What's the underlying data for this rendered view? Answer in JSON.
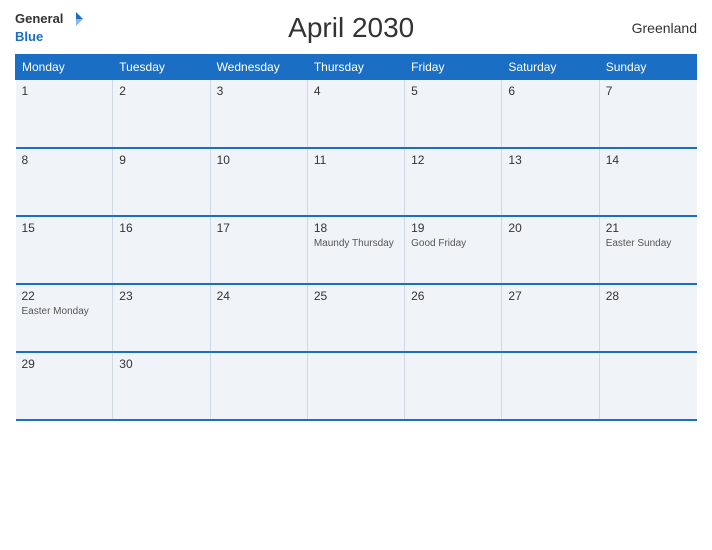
{
  "header": {
    "logo_general": "General",
    "logo_blue": "Blue",
    "title": "April 2030",
    "region": "Greenland"
  },
  "calendar": {
    "weekdays": [
      "Monday",
      "Tuesday",
      "Wednesday",
      "Thursday",
      "Friday",
      "Saturday",
      "Sunday"
    ],
    "weeks": [
      [
        {
          "day": "1",
          "event": ""
        },
        {
          "day": "2",
          "event": ""
        },
        {
          "day": "3",
          "event": ""
        },
        {
          "day": "4",
          "event": ""
        },
        {
          "day": "5",
          "event": ""
        },
        {
          "day": "6",
          "event": ""
        },
        {
          "day": "7",
          "event": ""
        }
      ],
      [
        {
          "day": "8",
          "event": ""
        },
        {
          "day": "9",
          "event": ""
        },
        {
          "day": "10",
          "event": ""
        },
        {
          "day": "11",
          "event": ""
        },
        {
          "day": "12",
          "event": ""
        },
        {
          "day": "13",
          "event": ""
        },
        {
          "day": "14",
          "event": ""
        }
      ],
      [
        {
          "day": "15",
          "event": ""
        },
        {
          "day": "16",
          "event": ""
        },
        {
          "day": "17",
          "event": ""
        },
        {
          "day": "18",
          "event": "Maundy Thursday"
        },
        {
          "day": "19",
          "event": "Good Friday"
        },
        {
          "day": "20",
          "event": ""
        },
        {
          "day": "21",
          "event": "Easter Sunday"
        }
      ],
      [
        {
          "day": "22",
          "event": "Easter Monday"
        },
        {
          "day": "23",
          "event": ""
        },
        {
          "day": "24",
          "event": ""
        },
        {
          "day": "25",
          "event": ""
        },
        {
          "day": "26",
          "event": ""
        },
        {
          "day": "27",
          "event": ""
        },
        {
          "day": "28",
          "event": ""
        }
      ],
      [
        {
          "day": "29",
          "event": ""
        },
        {
          "day": "30",
          "event": ""
        },
        {
          "day": "",
          "event": ""
        },
        {
          "day": "",
          "event": ""
        },
        {
          "day": "",
          "event": ""
        },
        {
          "day": "",
          "event": ""
        },
        {
          "day": "",
          "event": ""
        }
      ]
    ]
  }
}
